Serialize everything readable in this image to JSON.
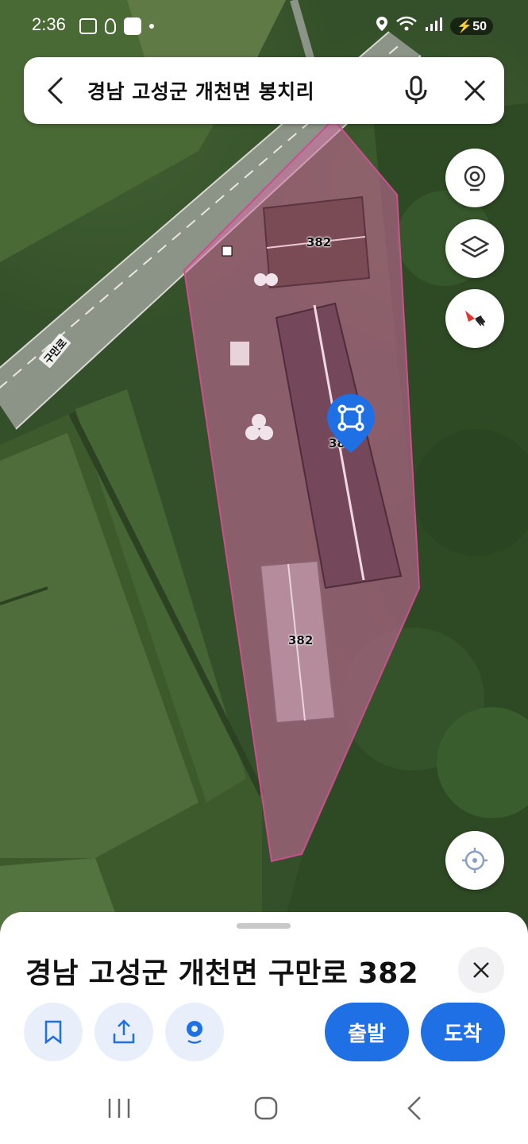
{
  "status_bar": {
    "time": "2:36",
    "battery": "50",
    "icons": [
      "screenshot-icon",
      "gesture-icon",
      "app-icon",
      "dot-icon",
      "location-icon",
      "wifi-icon",
      "signal-icon",
      "battery-icon"
    ]
  },
  "search": {
    "query": "경남 고성군 개천면 봉치리"
  },
  "map": {
    "road_name": "구만로",
    "parcel_labels": [
      "382",
      "38",
      "382"
    ],
    "parcel_color": "#d46aa0",
    "controls": [
      "street-view-icon",
      "layers-icon",
      "compass-icon",
      "my-location-icon"
    ]
  },
  "sheet": {
    "address": "경남 고성군 개천면 구만로 382",
    "depart_label": "출발",
    "arrive_label": "도착",
    "accent_color": "#1f6fe5",
    "actions": [
      "bookmark-icon",
      "share-icon",
      "roadview-icon"
    ]
  },
  "navbar": {
    "buttons": [
      "recent-apps-icon",
      "home-icon",
      "back-icon"
    ]
  }
}
